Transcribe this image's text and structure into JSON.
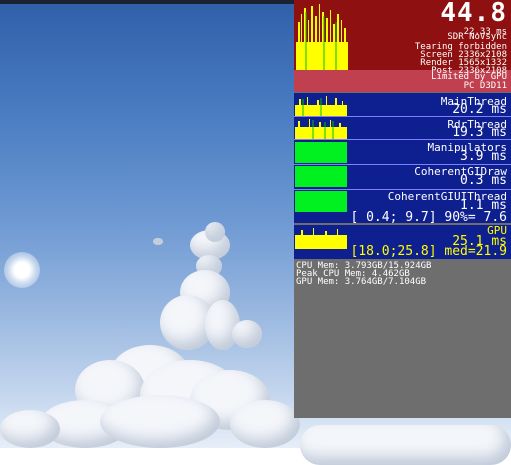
{
  "header": {
    "fps": "44.8",
    "frame_ms": "22.33 ms",
    "mode": "SDR NoVsync",
    "tearing": "Tearing forbidden",
    "screen": "Screen 2336x2108",
    "render": "Render 1565x1332",
    "post": "Post 2336x2108",
    "limited": "Limited by GPU",
    "api": "PC D3D11"
  },
  "threads": [
    {
      "name": "MainThread",
      "value": "20.2 ms"
    },
    {
      "name": "RdrThread",
      "value": "19.3 ms"
    },
    {
      "name": "Manipulators",
      "value": "3.9 ms"
    },
    {
      "name": "CoherentGIDraw",
      "value": "0.3 ms"
    },
    {
      "name": "CoherentGIUIThread",
      "value": "1.1 ms"
    }
  ],
  "range_line": "[ 0.4; 9.7] 90%= 7.6",
  "gpu": {
    "label": "GPU",
    "value": "25.1 ms",
    "range": "[18.0;25.8] med=21.9"
  },
  "memory": {
    "cpu": "CPU Mem: 3.793GB/15.924GB",
    "peak": "Peak CPU Mem: 4.462GB",
    "gpu": "GPU Mem: 3.764GB/7.104GB"
  },
  "colors": {
    "header_bg": "#8e1010",
    "panel_bg": "#0e1f8f",
    "accent_yellow": "#ffff00",
    "green": "#00f020"
  }
}
